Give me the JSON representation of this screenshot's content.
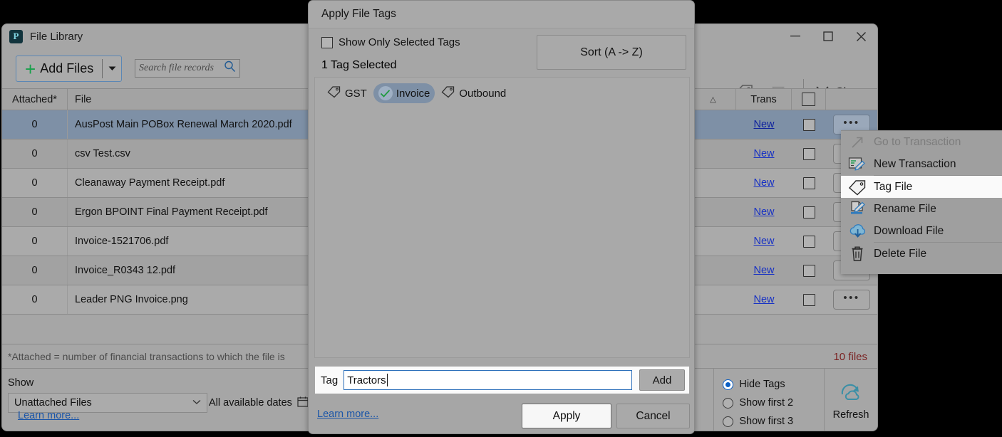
{
  "main_window": {
    "app_icon": "app-logo-icon",
    "title": "File Library",
    "window_controls": {
      "minimize": "—",
      "maximize": "▢",
      "close": "✕"
    },
    "toolbar": {
      "add_files_label": "Add Files",
      "add_files_plus": "+",
      "add_files_caret": "▼",
      "search_placeholder": "Search file records",
      "tag_tool": "tag-edit-icon",
      "delete_tool": "delete-checked-icon",
      "close_label_pre": "C",
      "close_label_rest": "lose"
    },
    "grid": {
      "columns": [
        "Attached*",
        "File",
        "",
        "Trans",
        "",
        ""
      ],
      "sort_marker": "△",
      "rows": [
        {
          "attached": "0",
          "file": "AusPost Main POBox Renewal March 2020.pdf",
          "trans": "New",
          "more": "•••",
          "selected": true
        },
        {
          "attached": "0",
          "file": "csv Test.csv",
          "trans": "New",
          "more": "•••",
          "selected": false
        },
        {
          "attached": "0",
          "file": "Cleanaway Payment Receipt.pdf",
          "trans": "New",
          "more": "•••",
          "selected": false
        },
        {
          "attached": "0",
          "file": "Ergon BPOINT Final Payment Receipt.pdf",
          "trans": "New",
          "more": "•••",
          "selected": false
        },
        {
          "attached": "0",
          "file": "Invoice-1521706.pdf",
          "trans": "New",
          "more": "•••",
          "selected": false
        },
        {
          "attached": "0",
          "file": "Invoice_R0343 12.pdf",
          "trans": "New",
          "more": "•••",
          "selected": false
        },
        {
          "attached": "0",
          "file": "Leader PNG Invoice.png",
          "trans": "New",
          "more": "•••",
          "selected": false
        }
      ]
    },
    "footnote": "*Attached = number of financial transactions to which the file is",
    "files_count": "10 files",
    "bottom": {
      "show_label": "Show",
      "show_value": "Unattached Files",
      "show_caret": "⌄",
      "dates_label": "All available dates",
      "dates_icon": "calendar-icon",
      "learn_more": "Learn more...",
      "tag_display_options": [
        {
          "label": "Hide Tags",
          "selected": true
        },
        {
          "label": "Show first 2",
          "selected": false
        },
        {
          "label": "Show first 3",
          "selected": false
        }
      ],
      "refresh_label": "Refresh",
      "refresh_icon": "refresh-cloud-icon"
    }
  },
  "dialog": {
    "title": "Apply File Tags",
    "show_only_selected_label": "Show Only Selected Tags",
    "show_only_selected_checked": false,
    "selected_count": "1 Tag Selected",
    "sort_button": "Sort (A -> Z)",
    "tags": [
      {
        "label": "GST",
        "selected": false
      },
      {
        "label": "Invoice",
        "selected": true
      },
      {
        "label": "Outbound",
        "selected": false
      }
    ],
    "tag_field_label": "Tag",
    "tag_field_value": "Tractors",
    "tag_field_placeholder": "",
    "add_button": "Add",
    "learn_more": "Learn more...",
    "apply_button": "Apply",
    "cancel_button": "Cancel"
  },
  "context_menu": {
    "items": [
      {
        "label": "Go to Transaction",
        "icon": "arrow-up-right-icon",
        "disabled": true,
        "highlighted": false,
        "sep_after": false
      },
      {
        "label": "New Transaction",
        "icon": "new-transaction-icon",
        "disabled": false,
        "highlighted": false,
        "sep_after": true
      },
      {
        "label": "Tag File",
        "icon": "tag-icon",
        "disabled": false,
        "highlighted": true,
        "sep_after": false
      },
      {
        "label": "Rename File",
        "icon": "rename-file-icon",
        "disabled": false,
        "highlighted": false,
        "sep_after": false
      },
      {
        "label": "Download File",
        "icon": "download-cloud-icon",
        "disabled": false,
        "highlighted": false,
        "sep_after": true
      },
      {
        "label": "Delete File",
        "icon": "trash-icon",
        "disabled": false,
        "highlighted": false,
        "sep_after": false
      }
    ]
  },
  "colors": {
    "window_bg": "#a6a6a6",
    "row_selected": "#7e90a6",
    "link": "#1731c4",
    "accent_red": "#7a2222",
    "accent_blue": "#0b5fc4",
    "green_check": "#19a04b"
  }
}
